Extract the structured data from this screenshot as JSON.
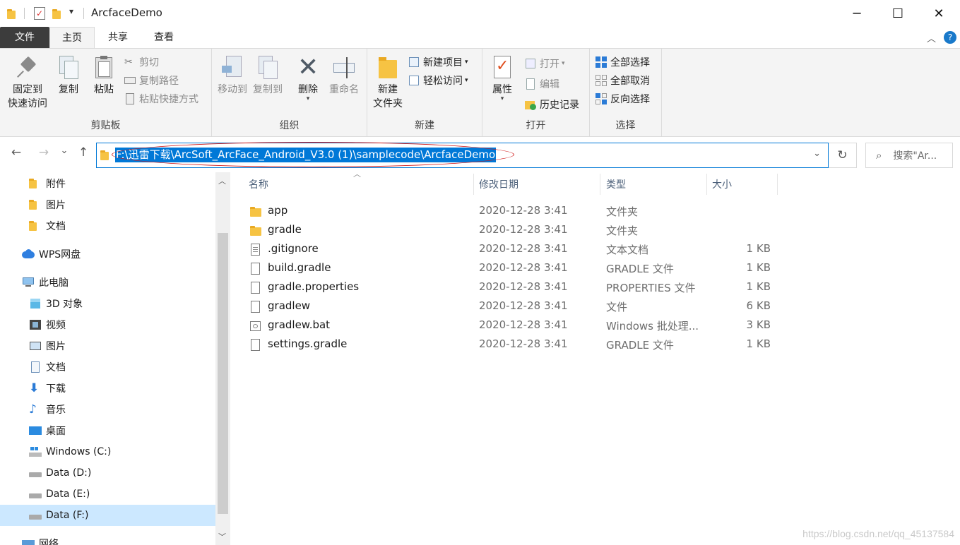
{
  "window": {
    "title": "ArcfaceDemo",
    "controls": {
      "minimize": "─",
      "maximize": "☐",
      "close": "✕"
    }
  },
  "tabs": {
    "file": "文件",
    "home": "主页",
    "share": "共享",
    "view": "查看"
  },
  "ribbon": {
    "clipboard": {
      "title": "剪贴板",
      "pin_line1": "固定到",
      "pin_line2": "快速访问",
      "copy": "复制",
      "paste": "粘贴",
      "cut": "剪切",
      "copy_path": "复制路径",
      "paste_shortcut": "粘贴快捷方式"
    },
    "organize": {
      "title": "组织",
      "move_to": "移动到",
      "copy_to": "复制到",
      "delete": "删除",
      "rename": "重命名"
    },
    "new": {
      "title": "新建",
      "new_folder_line1": "新建",
      "new_folder_line2": "文件夹",
      "new_item": "新建项目",
      "easy_access": "轻松访问"
    },
    "open": {
      "title": "打开",
      "properties": "属性",
      "open": "打开",
      "edit": "编辑",
      "history": "历史记录"
    },
    "select": {
      "title": "选择",
      "select_all": "全部选择",
      "select_none": "全部取消",
      "invert": "反向选择"
    }
  },
  "navbar": {
    "back": "←",
    "forward": "→",
    "recent": "⌄",
    "up": "↑",
    "address": "F:\\迅雷下载\\ArcSoft_ArcFace_Android_V3.0 (1)\\samplecode\\ArcfaceDemo",
    "refresh": "↻",
    "search_placeholder": "搜索\"Ar..."
  },
  "sidebar": {
    "items": [
      {
        "label": "附件"
      },
      {
        "label": "图片"
      },
      {
        "label": "文档"
      },
      {
        "label": "WPS网盘"
      },
      {
        "label": "此电脑"
      },
      {
        "label": "3D 对象"
      },
      {
        "label": "视频"
      },
      {
        "label": "图片"
      },
      {
        "label": "文档"
      },
      {
        "label": "下载"
      },
      {
        "label": "音乐"
      },
      {
        "label": "桌面"
      },
      {
        "label": "Windows (C:)"
      },
      {
        "label": "Data (D:)"
      },
      {
        "label": "Data (E:)"
      },
      {
        "label": "Data (F:)"
      },
      {
        "label": "网络"
      }
    ]
  },
  "file_list": {
    "columns": {
      "name": "名称",
      "modified": "修改日期",
      "type": "类型",
      "size": "大小"
    },
    "rows": [
      {
        "name": "app",
        "modified": "2020-12-28 3:41",
        "type": "文件夹",
        "size": ""
      },
      {
        "name": "gradle",
        "modified": "2020-12-28 3:41",
        "type": "文件夹",
        "size": ""
      },
      {
        "name": ".gitignore",
        "modified": "2020-12-28 3:41",
        "type": "文本文档",
        "size": "1 KB"
      },
      {
        "name": "build.gradle",
        "modified": "2020-12-28 3:41",
        "type": "GRADLE 文件",
        "size": "1 KB"
      },
      {
        "name": "gradle.properties",
        "modified": "2020-12-28 3:41",
        "type": "PROPERTIES 文件",
        "size": "1 KB"
      },
      {
        "name": "gradlew",
        "modified": "2020-12-28 3:41",
        "type": "文件",
        "size": "6 KB"
      },
      {
        "name": "gradlew.bat",
        "modified": "2020-12-28 3:41",
        "type": "Windows 批处理...",
        "size": "3 KB"
      },
      {
        "name": "settings.gradle",
        "modified": "2020-12-28 3:41",
        "type": "GRADLE 文件",
        "size": "1 KB"
      }
    ]
  },
  "watermark": "https://blog.csdn.net/qq_45137584",
  "colors": {
    "accent": "#0078d7",
    "selection": "#cce8ff",
    "annotation": "#d01818",
    "folder": "#f6c343"
  }
}
